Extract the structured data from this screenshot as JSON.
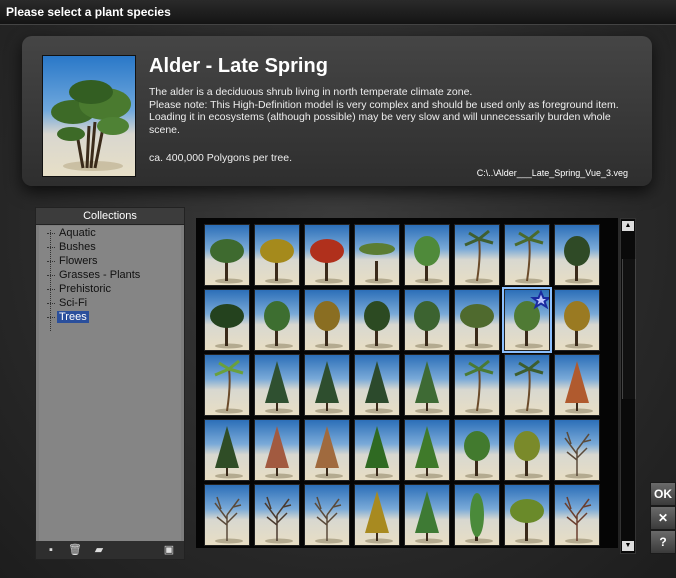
{
  "window": {
    "title": "Please select a plant species"
  },
  "info": {
    "title": "Alder - Late Spring",
    "description": [
      "The alder is a deciduous shrub living in north temperate climate zone.",
      "Please note: This High-Definition model is very complex and should be used only as foreground item. Loading it in ecosystems (although possible) may be very slow and will unnecessarily burden whole scene."
    ],
    "polygons": "ca. 400,000 Polygons per tree.",
    "file_path": "C:\\..\\Alder___Late_Spring_Vue_3.veg"
  },
  "collections": {
    "header": "Collections",
    "items": [
      {
        "label": "Aquatic",
        "selected": false
      },
      {
        "label": "Bushes",
        "selected": false
      },
      {
        "label": "Flowers",
        "selected": false
      },
      {
        "label": "Grasses - Plants",
        "selected": false
      },
      {
        "label": "Prehistoric",
        "selected": false
      },
      {
        "label": "Sci-Fi",
        "selected": false
      },
      {
        "label": "Trees",
        "selected": true
      }
    ],
    "toolbar_icons": [
      "new-collection-icon",
      "delete-icon",
      "open-folder-icon",
      "browse-icon"
    ]
  },
  "grid": {
    "rows": 5,
    "columns": 8,
    "selected_index": 14,
    "thumbnails": [
      {
        "foliage": "#3e6a2f",
        "shape": "wide"
      },
      {
        "foliage": "#a58a1c",
        "shape": "wide"
      },
      {
        "foliage": "#b0301c",
        "shape": "wide"
      },
      {
        "foliage": "#5b7d33",
        "shape": "flat"
      },
      {
        "foliage": "#4f8a3a",
        "shape": "round"
      },
      {
        "foliage": "#3f5f30",
        "shape": "palm"
      },
      {
        "foliage": "#4a6a2c",
        "shape": "palm"
      },
      {
        "foliage": "#2f4a26",
        "shape": "round"
      },
      {
        "foliage": "#24421e",
        "shape": "wide"
      },
      {
        "foliage": "#3d6e30",
        "shape": "round"
      },
      {
        "foliage": "#8a6e22",
        "shape": "round"
      },
      {
        "foliage": "#2c4a22",
        "shape": "round"
      },
      {
        "foliage": "#3c6330",
        "shape": "round"
      },
      {
        "foliage": "#4f6a2e",
        "shape": "wide"
      },
      {
        "foliage": "#4f7a34",
        "shape": "round"
      },
      {
        "foliage": "#9a7a22",
        "shape": "round"
      },
      {
        "foliage": "#6aa03c",
        "shape": "palm"
      },
      {
        "foliage": "#2f5030",
        "shape": "conifer"
      },
      {
        "foliage": "#2e4e2e",
        "shape": "conifer"
      },
      {
        "foliage": "#2c4a2c",
        "shape": "conifer"
      },
      {
        "foliage": "#3e6a34",
        "shape": "conifer"
      },
      {
        "foliage": "#4a7a34",
        "shape": "palm"
      },
      {
        "foliage": "#3d5e2e",
        "shape": "palm"
      },
      {
        "foliage": "#b05a2e",
        "shape": "conifer"
      },
      {
        "foliage": "#2f4d26",
        "shape": "conifer"
      },
      {
        "foliage": "#a25a40",
        "shape": "conifer"
      },
      {
        "foliage": "#a06a3e",
        "shape": "conifer"
      },
      {
        "foliage": "#2f6a22",
        "shape": "conifer"
      },
      {
        "foliage": "#3f7a2a",
        "shape": "conifer"
      },
      {
        "foliage": "#427a2e",
        "shape": "round"
      },
      {
        "foliage": "#7a8a2a",
        "shape": "round"
      },
      {
        "foliage": "#5a4a3a",
        "shape": "bare"
      },
      {
        "foliage": "#5a4a3a",
        "shape": "bare"
      },
      {
        "foliage": "#4a3a2e",
        "shape": "bare"
      },
      {
        "foliage": "#5a4a3a",
        "shape": "bare"
      },
      {
        "foliage": "#a88a20",
        "shape": "conifer"
      },
      {
        "foliage": "#3e7a34",
        "shape": "conifer"
      },
      {
        "foliage": "#4a8a3a",
        "shape": "column"
      },
      {
        "foliage": "#6a8a2a",
        "shape": "wide"
      },
      {
        "foliage": "#6a3e2e",
        "shape": "bare"
      }
    ]
  },
  "buttons": {
    "ok": "OK",
    "cancel": "✕",
    "help": "?"
  }
}
